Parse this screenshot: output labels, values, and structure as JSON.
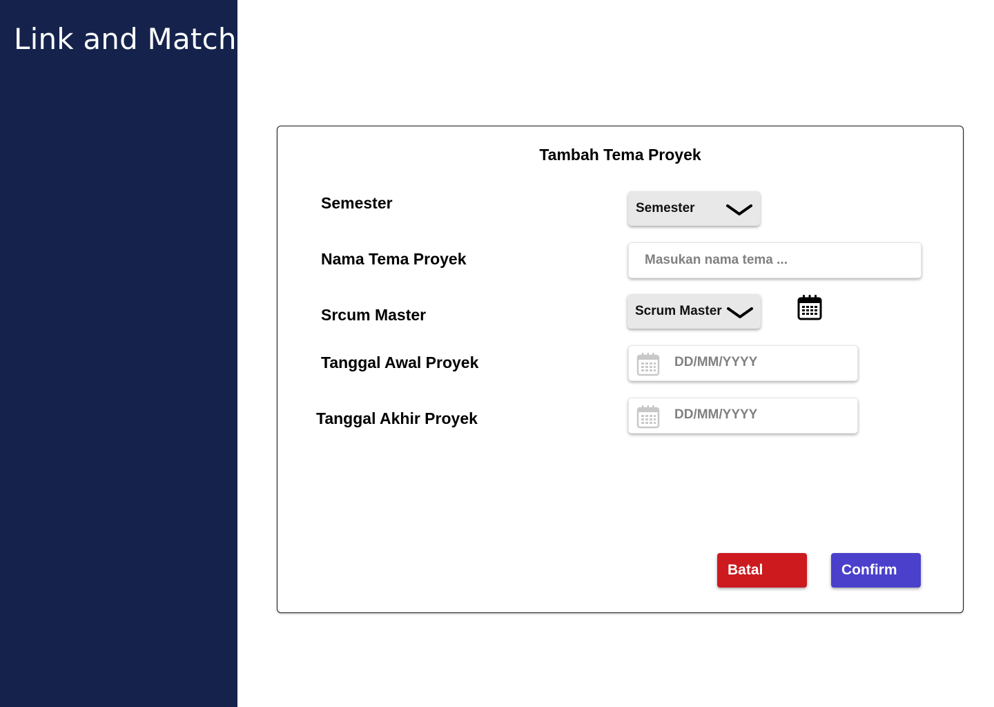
{
  "app": {
    "brand": "Link and Match"
  },
  "colors": {
    "sidebar": "#15234c",
    "cancel": "#cc1a1f",
    "confirm": "#4b40cc"
  },
  "form": {
    "title": "Tambah Tema Proyek",
    "labels": {
      "semester": "Semester",
      "nama_tema": "Nama Tema Proyek",
      "scrum_master": "Srcum Master",
      "tanggal_awal": "Tanggal Awal Proyek",
      "tanggal_akhir": "Tanggal Akhir Proyek"
    },
    "semester_select": {
      "value": "Semester",
      "icon": "chevron-down-icon"
    },
    "nama_tema_input": {
      "placeholder": "Masukan nama tema ..."
    },
    "scrum_master_select": {
      "value": "Scrum Master",
      "icon": "chevron-down-icon"
    },
    "tanggal_awal_input": {
      "placeholder": "DD/MM/YYYY",
      "icon": "calendar-icon"
    },
    "tanggal_akhir_input": {
      "placeholder": "DD/MM/YYYY",
      "icon": "calendar-icon"
    },
    "buttons": {
      "cancel": "Batal",
      "confirm": "Confirm"
    }
  }
}
